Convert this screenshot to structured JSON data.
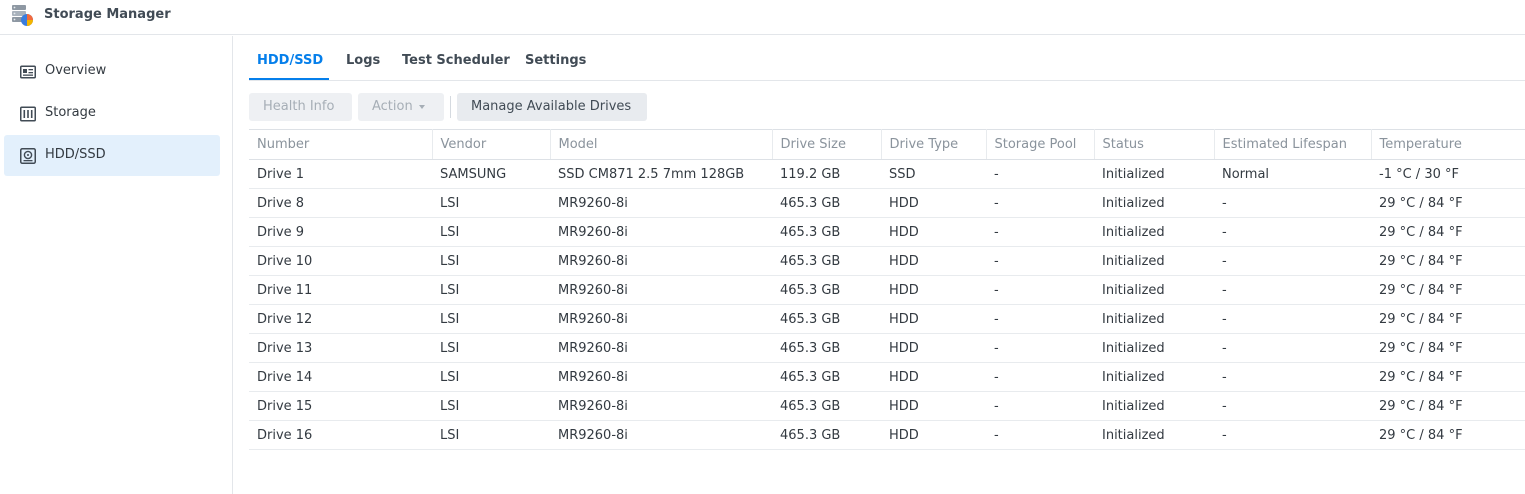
{
  "app": {
    "title": "Storage Manager",
    "icon": "storage-manager-icon"
  },
  "sidebar": {
    "items": [
      {
        "label": "Overview",
        "icon": "overview-icon",
        "active": false
      },
      {
        "label": "Storage",
        "icon": "storage-icon",
        "active": false
      },
      {
        "label": "HDD/SSD",
        "icon": "hdd-icon",
        "active": true
      }
    ]
  },
  "tabs": [
    {
      "label": "HDD/SSD",
      "active": true
    },
    {
      "label": "Logs",
      "active": false
    },
    {
      "label": "Test Scheduler",
      "active": false
    },
    {
      "label": "Settings",
      "active": false
    }
  ],
  "toolbar": {
    "health_info": "Health Info",
    "action": "Action",
    "manage_drives": "Manage Available Drives"
  },
  "colors": {
    "accent": "#057feb",
    "ok": "#2b9b2b",
    "active_bg": "#e3f0fc"
  },
  "table": {
    "headers": [
      "Number",
      "Vendor",
      "Model",
      "Drive Size",
      "Drive Type",
      "Storage Pool",
      "Status",
      "Estimated Lifespan",
      "Temperature"
    ],
    "rows": [
      [
        "Drive 1",
        "SAMSUNG",
        "SSD CM871 2.5 7mm 128GB",
        "119.2 GB",
        "SSD",
        "-",
        "Initialized",
        "Normal",
        "-1 °C / 30 °F"
      ],
      [
        "Drive 8",
        "LSI",
        "MR9260-8i",
        "465.3 GB",
        "HDD",
        "-",
        "Initialized",
        "-",
        "29 °C / 84 °F"
      ],
      [
        "Drive 9",
        "LSI",
        "MR9260-8i",
        "465.3 GB",
        "HDD",
        "-",
        "Initialized",
        "-",
        "29 °C / 84 °F"
      ],
      [
        "Drive 10",
        "LSI",
        "MR9260-8i",
        "465.3 GB",
        "HDD",
        "-",
        "Initialized",
        "-",
        "29 °C / 84 °F"
      ],
      [
        "Drive 11",
        "LSI",
        "MR9260-8i",
        "465.3 GB",
        "HDD",
        "-",
        "Initialized",
        "-",
        "29 °C / 84 °F"
      ],
      [
        "Drive 12",
        "LSI",
        "MR9260-8i",
        "465.3 GB",
        "HDD",
        "-",
        "Initialized",
        "-",
        "29 °C / 84 °F"
      ],
      [
        "Drive 13",
        "LSI",
        "MR9260-8i",
        "465.3 GB",
        "HDD",
        "-",
        "Initialized",
        "-",
        "29 °C / 84 °F"
      ],
      [
        "Drive 14",
        "LSI",
        "MR9260-8i",
        "465.3 GB",
        "HDD",
        "-",
        "Initialized",
        "-",
        "29 °C / 84 °F"
      ],
      [
        "Drive 15",
        "LSI",
        "MR9260-8i",
        "465.3 GB",
        "HDD",
        "-",
        "Initialized",
        "-",
        "29 °C / 84 °F"
      ],
      [
        "Drive 16",
        "LSI",
        "MR9260-8i",
        "465.3 GB",
        "HDD",
        "-",
        "Initialized",
        "-",
        "29 °C / 84 °F"
      ]
    ]
  }
}
